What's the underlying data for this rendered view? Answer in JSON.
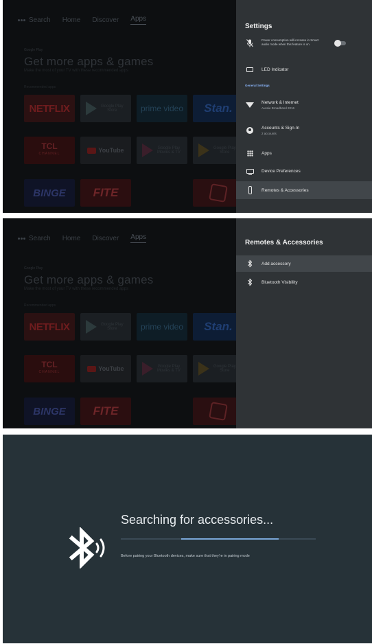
{
  "home": {
    "nav": [
      "Search",
      "Home",
      "Discover",
      "Apps"
    ],
    "active_nav": "Apps",
    "brand": "Google Play",
    "title": "Get more apps & games",
    "subtitle": "Make the most of your TV with these recommended apps",
    "section": "Recommended apps",
    "tiles": {
      "netflix": "NETFLIX",
      "google_play": "Google Play",
      "google_play_sub": "Store",
      "prime": "prime video",
      "stan": "Stan.",
      "tcl": "TCL",
      "tcl_sub": "CHANNEL",
      "youtube": "YouTube",
      "gp_movies": "Google Play",
      "gp_movies_sub": "Movies & TV",
      "gp_games": "Google Play",
      "gp_games_sub": "Store",
      "binge": "BINGE",
      "fite": "FITE"
    }
  },
  "settings": {
    "title": "Settings",
    "power_notice": "Power consumption will increase in Smart audio mode when this feature is on.",
    "led": "LED Indicator",
    "section_general": "General Settings",
    "network": "Network & Internet",
    "network_sub": "Aussie Broadband 2016",
    "accounts": "Accounts & Sign-In",
    "accounts_sub": "2 accounts",
    "apps": "Apps",
    "device": "Device Preferences",
    "remotes": "Remotes & Accessories"
  },
  "remotes": {
    "title": "Remotes & Accessories",
    "add": "Add accessory",
    "visibility": "Bluetooth Visibility"
  },
  "searching": {
    "title": "Searching for accessories...",
    "hint": "Before pairing your Bluetooth devices, make sure that they're in pairing mode",
    "progress_start": 0.31,
    "progress_width": 0.5
  }
}
